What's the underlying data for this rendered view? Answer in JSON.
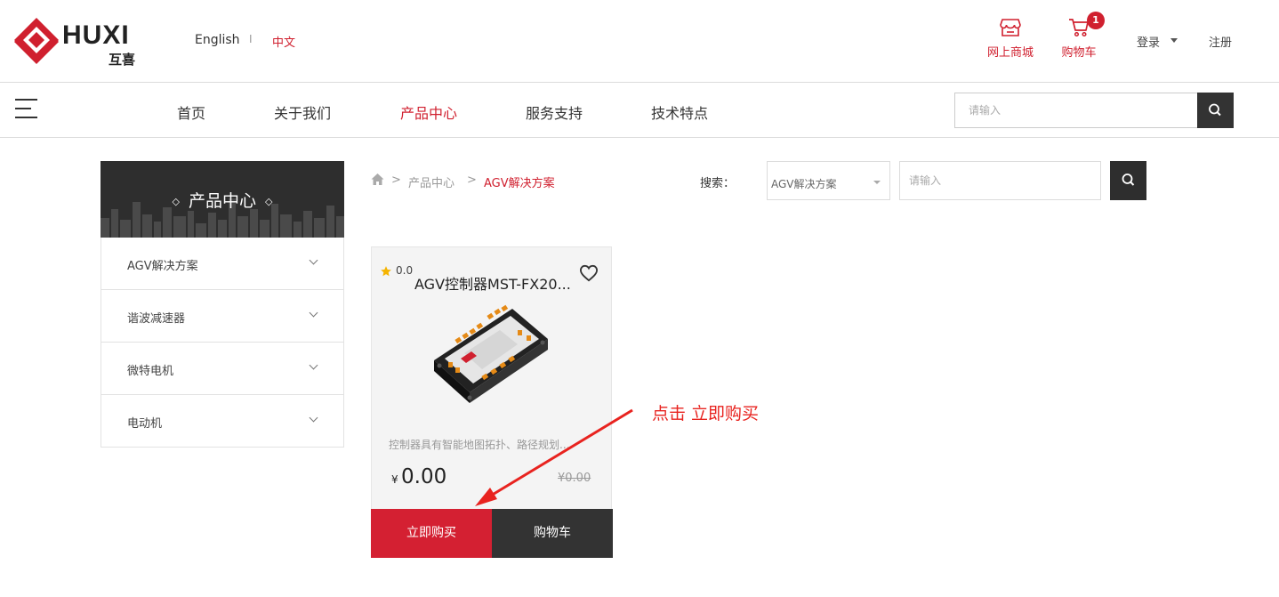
{
  "header": {
    "logo_text": "HUXI",
    "logo_sub": "互喜",
    "lang_english": "English",
    "lang_separator": "I",
    "lang_chinese": "中文",
    "shop_label": "网上商城",
    "cart_label": "购物车",
    "cart_count": "1",
    "login_label": "登录",
    "register_label": "注册"
  },
  "nav": {
    "items": [
      "首页",
      "关于我们",
      "产品中心",
      "服务支持",
      "技术特点"
    ],
    "active_index": 2,
    "search_placeholder": "请输入"
  },
  "sidebar": {
    "title": "产品中心",
    "items": [
      "AGV解决方案",
      "谐波减速器",
      "微特电机",
      "电动机"
    ]
  },
  "breadcrumb": {
    "sep": ">",
    "level1": "产品中心",
    "current": "AGV解决方案"
  },
  "filter": {
    "label": "搜索：",
    "category_value": "AGV解决方案",
    "input_placeholder": "请输入"
  },
  "product": {
    "rating": "0.0",
    "title": "AGV控制器MST-FX20...",
    "description": "控制器具有智能地图拓扑、路径规划...",
    "currency": "¥",
    "price": "0.00",
    "original_price": "¥0.00",
    "buy_label": "立即购买",
    "cart_label": "购物车"
  },
  "annotation": {
    "text": "点击 立即购买"
  },
  "colors": {
    "accent": "#d0202f",
    "dark": "#333333",
    "star": "#f5b400",
    "annotation": "#e8231f"
  }
}
